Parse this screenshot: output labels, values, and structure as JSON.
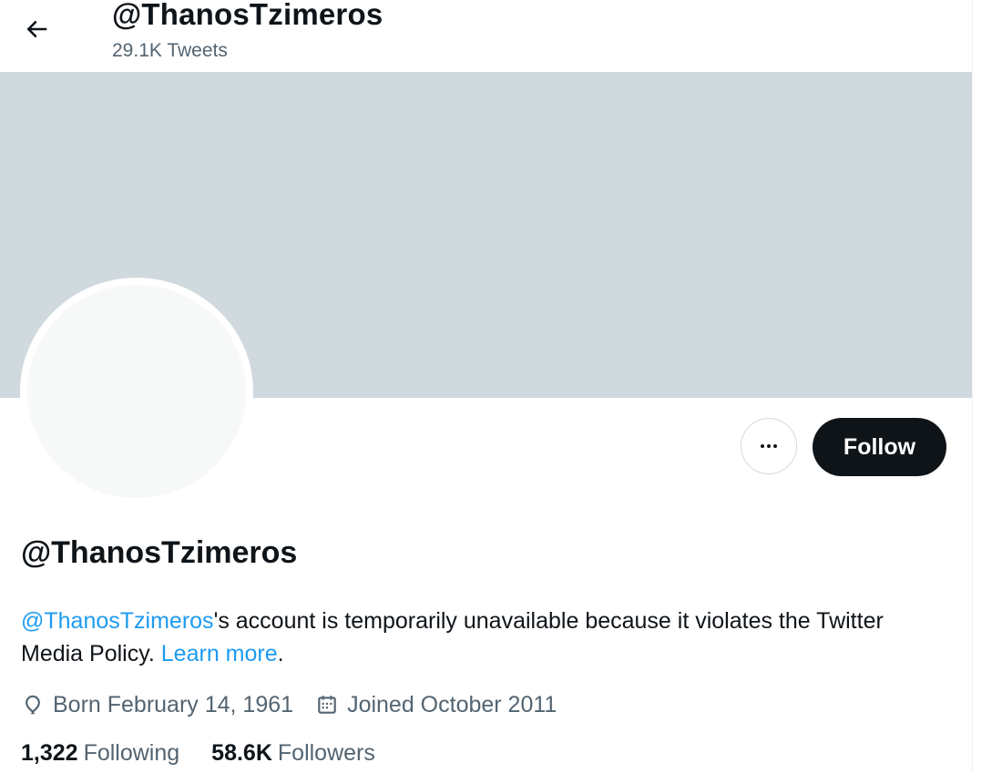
{
  "header": {
    "title": "@ThanosTzimeros",
    "tweet_count": "29.1K Tweets",
    "back_icon": "arrow-left-icon"
  },
  "banner": {
    "color": "#cfd9de"
  },
  "actions": {
    "more_icon": "more-horizontal-icon",
    "follow_label": "Follow"
  },
  "profile": {
    "name": "@ThanosTzimeros",
    "bio_mention": "@ThanosTzimeros",
    "bio_text": "'s account is temporarily unavailable because it violates the Twitter Media Policy.",
    "bio_link": "Learn more",
    "bio_end": ".",
    "born": "Born February 14, 1961",
    "born_icon": "balloon-icon",
    "joined": "Joined October 2011",
    "joined_icon": "calendar-icon"
  },
  "stats": {
    "following_count": "1,322",
    "following_label": "Following",
    "followers_count": "58.6K",
    "followers_label": "Followers"
  },
  "colors": {
    "text": "#0f1419",
    "secondary_text": "#536471",
    "link": "#1d9bf0",
    "follow_bg": "#0f1419"
  }
}
